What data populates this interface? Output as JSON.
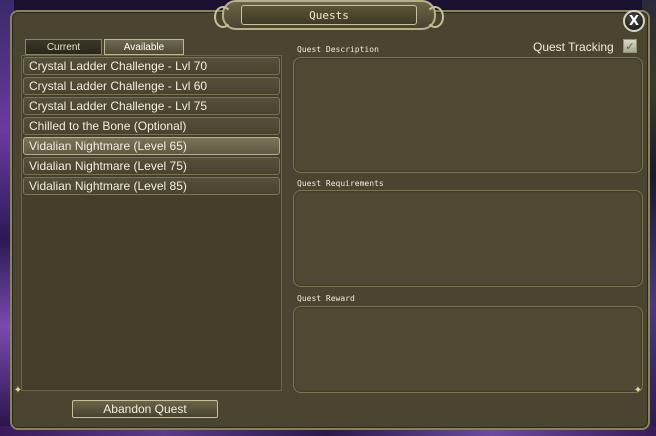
{
  "window": {
    "title": "Quests",
    "close_label": "X"
  },
  "tabs": [
    {
      "label": "Current",
      "active": false
    },
    {
      "label": "Available",
      "active": true
    }
  ],
  "quests": [
    {
      "name": "Crystal Ladder Challenge - Lvl 70",
      "selected": false
    },
    {
      "name": "Crystal Ladder Challenge - Lvl 60",
      "selected": false
    },
    {
      "name": "Crystal Ladder Challenge - Lvl 75",
      "selected": false
    },
    {
      "name": "Chilled to the Bone (Optional)",
      "selected": false
    },
    {
      "name": "Vidalian Nightmare (Level 65)",
      "selected": true
    },
    {
      "name": "Vidalian Nightmare (Level 75)",
      "selected": false
    },
    {
      "name": "Vidalian Nightmare (Level 85)",
      "selected": false
    }
  ],
  "details": {
    "description_label": "Quest Description",
    "requirements_label": "Quest Requirements",
    "reward_label": "Quest Reward",
    "description": "",
    "requirements": "",
    "reward": ""
  },
  "tracking": {
    "label": "Quest Tracking",
    "checked": true,
    "check_glyph": "✓"
  },
  "actions": {
    "abandon_label": "Abandon Quest"
  },
  "icons": {
    "close": "close-icon",
    "check": "checkmark-icon"
  },
  "colors": {
    "panel_bg": "#4a4530",
    "border": "#8a8258",
    "text": "#f2eee0"
  }
}
